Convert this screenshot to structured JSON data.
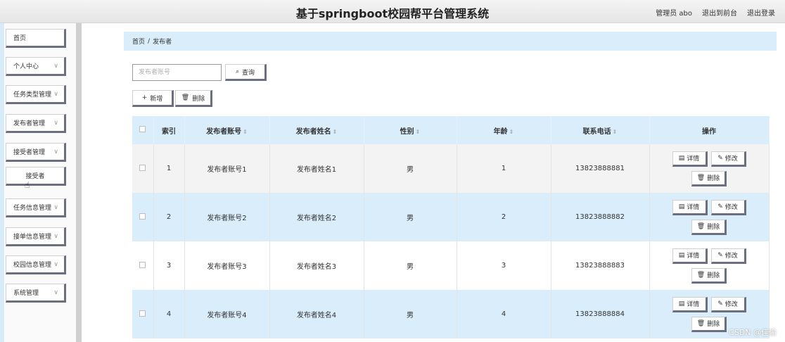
{
  "header": {
    "title": "基于springboot校园帮平台管理系统",
    "user_label": "管理员 abo",
    "back_link": "退出到前台",
    "logout_link": "退出登录"
  },
  "sidebar": {
    "items": [
      {
        "label": "首页",
        "has_children": false
      },
      {
        "label": "个人中心",
        "has_children": true
      },
      {
        "label": "任务类型管理",
        "has_children": true
      },
      {
        "label": "发布者管理",
        "has_children": true
      },
      {
        "label": "接受者管理",
        "has_children": true
      },
      {
        "label": "接受者",
        "is_subitem": true
      },
      {
        "label": "任务信息管理",
        "has_children": true
      },
      {
        "label": "接单信息管理",
        "has_children": true
      },
      {
        "label": "校园信息管理",
        "has_children": true
      },
      {
        "label": "系统管理",
        "has_children": true
      }
    ],
    "chevron": "∨"
  },
  "breadcrumb": {
    "home": "首页",
    "separator": "/",
    "current": "发布者"
  },
  "toolbar": {
    "search_placeholder": "发布者账号",
    "search_label": "查询",
    "add_label": "新增",
    "delete_label": "删除"
  },
  "table": {
    "headers": {
      "index": "索引",
      "account": "发布者账号",
      "name": "发布者姓名",
      "gender": "性别",
      "age": "年龄",
      "phone": "联系电话",
      "actions": "操作"
    },
    "rows": [
      {
        "index": "1",
        "account": "发布者账号1",
        "name": "发布者姓名1",
        "gender": "男",
        "age": "1",
        "phone": "13823888881"
      },
      {
        "index": "2",
        "account": "发布者账号2",
        "name": "发布者姓名2",
        "gender": "男",
        "age": "2",
        "phone": "13823888882"
      },
      {
        "index": "3",
        "account": "发布者账号3",
        "name": "发布者姓名3",
        "gender": "男",
        "age": "3",
        "phone": "13823888883"
      },
      {
        "index": "4",
        "account": "发布者账号4",
        "name": "发布者姓名4",
        "gender": "男",
        "age": "4",
        "phone": "13823888884"
      }
    ],
    "actions": {
      "detail": "详情",
      "edit": "修改",
      "delete": "删除"
    }
  },
  "watermark": "CSDN @佳偷",
  "colors": {
    "accent": "#d9edfa",
    "button_shadow": "#6c6f80"
  }
}
